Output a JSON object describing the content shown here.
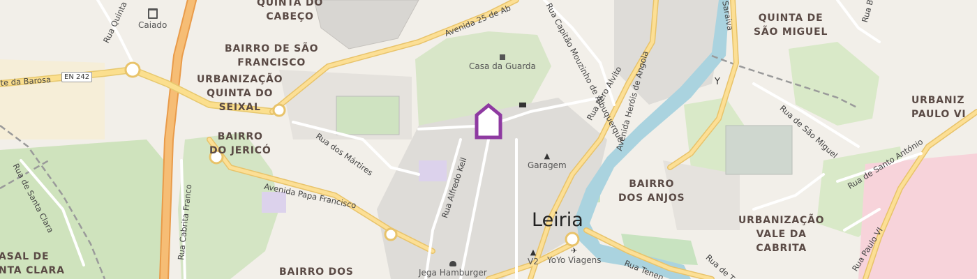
{
  "map": {
    "city_label": "Leiria",
    "districts": [
      {
        "id": "quinta-do-cabeco",
        "text": "QUINTA DO\nCABEÇO"
      },
      {
        "id": "bairro-de-sao-francisco",
        "text": "BAIRRO DE SÃO\nFRANCISCO"
      },
      {
        "id": "urbanizacao-quinta-do-seixal",
        "text": "URBANIZAÇÃO\nQUINTA DO\nSEIXAL"
      },
      {
        "id": "bairro-do-jerico",
        "text": "BAIRRO\nDO JERICÓ"
      },
      {
        "id": "quinta-de-sao-miguel",
        "text": "QUINTA DE\nSÃO MIGUEL"
      },
      {
        "id": "bairro-dos-anjos",
        "text": "BAIRRO\nDOS ANJOS"
      },
      {
        "id": "urbanizacao-vale-da-cabrita",
        "text": "URBANIZAÇÃO\nVALE DA\nCABRITA"
      },
      {
        "id": "urbanizacao-paulo-vi",
        "text": "URBANIZ\nPAULO VI"
      },
      {
        "id": "casal-de-santa-clara",
        "text": "ASAL DE\nNTA CLARA"
      },
      {
        "id": "bairro-dos",
        "text": "BAIRRO DOS"
      }
    ],
    "pois": [
      {
        "id": "caiado",
        "label": "Caiado",
        "icon": "shop-icon"
      },
      {
        "id": "casa-da-guarda",
        "label": "Casa da Guarda",
        "icon": "shop-icon"
      },
      {
        "id": "garagem",
        "label": "Garagem",
        "icon": "clothes-shop-icon"
      },
      {
        "id": "v2",
        "label": "V2",
        "icon": "clothes-shop-icon"
      },
      {
        "id": "yoyo-viagens",
        "label": "YoYo Viagens",
        "icon": "travel-agency-icon"
      },
      {
        "id": "hamburger",
        "label": "Jega Hamburger",
        "icon": "fast-food-icon"
      }
    ],
    "streets": [
      {
        "id": "avenida-25-de-abril",
        "label": "Avenida 25 de Ab"
      },
      {
        "id": "rua-capitao-mouzinho",
        "label": "Rua Capitão Mouzinho de Albuquerque"
      },
      {
        "id": "rua-pero-alvito",
        "label": "Rua Pêro Alvito"
      },
      {
        "id": "avenida-herois-de-angola",
        "label": "Avenida Heróis de Angola"
      },
      {
        "id": "rua-quinta",
        "label": "Rua Quinta do"
      },
      {
        "id": "estrada-barosa",
        "label": "te da Barosa"
      },
      {
        "id": "rua-dos-martires",
        "label": "Rua dos Mártires"
      },
      {
        "id": "avenida-papa-francisco",
        "label": "Avenida Papa Francisco"
      },
      {
        "id": "rua-alfredo-keil",
        "label": "Rua Alfredo Keil"
      },
      {
        "id": "rua-cabrita-franco",
        "label": "Rua Cabrita Franco"
      },
      {
        "id": "rua-de-santa-clara",
        "label": "Rua de Santa Clara"
      },
      {
        "id": "rua-de-sao-miguel",
        "label": "Rua de São Miguel"
      },
      {
        "id": "rua-de-santo-antonio",
        "label": "Rua de Santo António"
      },
      {
        "id": "rua-paulo-vi",
        "label": "Rua Paulo VI"
      },
      {
        "id": "rua-tenente",
        "label": "Rua Tenen"
      },
      {
        "id": "rua-de-t",
        "label": "Rua de T"
      },
      {
        "id": "saraiva",
        "label": "Saraiva"
      },
      {
        "id": "rua-b",
        "label": "Rua B"
      }
    ],
    "road_ref": "EN 242",
    "colors": {
      "background": "#f2efe9",
      "green": "#cde5b9",
      "residential": "#e0dfdf",
      "motorway": "#f2a55c",
      "primary": "#fcd885",
      "river": "#aad3df",
      "railway": "#8e8e8e",
      "hospital": "#f7d2d8",
      "school": "#dcd2ec",
      "marker": "#8e3aa1"
    },
    "marker": {
      "icon": "location-marker-icon"
    }
  }
}
